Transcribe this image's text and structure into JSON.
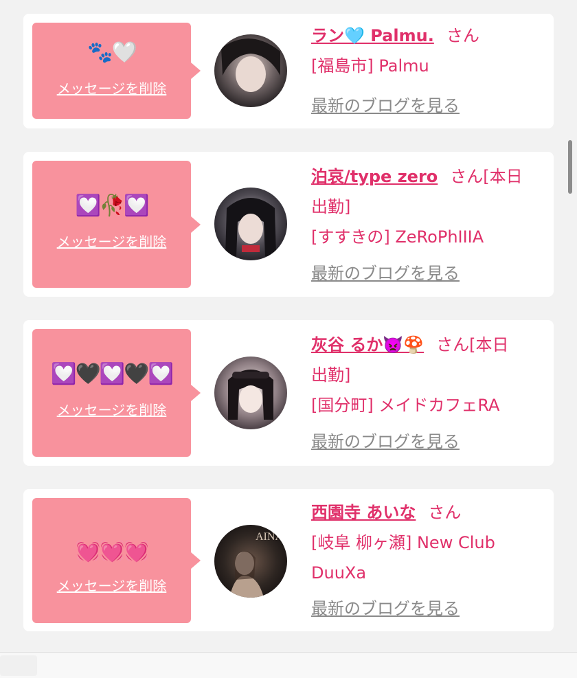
{
  "common": {
    "delete_label": "メッセージを削除",
    "blog_label": "最新のブログを見る",
    "san_label": "さん"
  },
  "cards": [
    {
      "emoji": "🐾🤍",
      "name": "ラン🩵 Palmu.",
      "suffix": "",
      "location_line1": "[福島市] Palmu",
      "location_line2": ""
    },
    {
      "emoji": "💟🥀💟",
      "name": "泊哀/type zero",
      "suffix": "[本日",
      "extra_line": "出勤]",
      "location_line1": "[すすきの] ZeRoPhIIIA"
    },
    {
      "emoji": "💟🖤💟🖤💟",
      "name": "灰谷 るか👿🍄",
      "suffix": "[本日",
      "extra_line": "出勤]",
      "location_line1": "[国分町] メイドカフェRA"
    },
    {
      "emoji": "💓💓💓",
      "name": "西園寺 あいな",
      "suffix": "",
      "location_line1": "[岐阜 柳ヶ瀬] New Club",
      "location_line2": "DuuXa"
    }
  ],
  "colors": {
    "accent": "#e0306a",
    "bubble": "#f8929d",
    "link_gray": "#8a8a8a",
    "background": "#f2f2f2"
  }
}
